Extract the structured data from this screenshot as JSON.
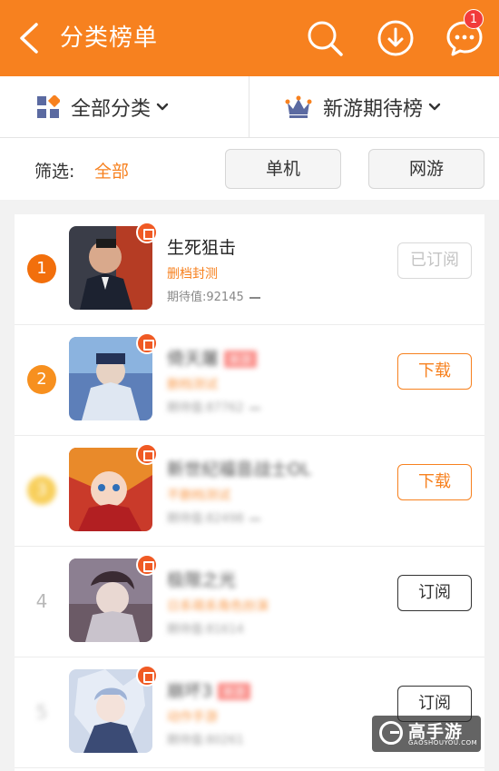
{
  "header": {
    "title": "分类榜单",
    "message_badge": "1",
    "icons": [
      "back-icon",
      "search-icon",
      "download-icon",
      "message-icon"
    ],
    "accent_color": "#f7811f"
  },
  "category_bar": {
    "left_label": "全部分类",
    "right_label": "新游期待榜"
  },
  "filter": {
    "label": "筛选:",
    "value": "全部",
    "buttons": [
      "单机",
      "网游"
    ]
  },
  "list": [
    {
      "rank": "1",
      "name": "生死狙击",
      "tag": "删档封测",
      "expect": "期待值:92145",
      "action": "已订阅"
    },
    {
      "rank": "2",
      "name": "倚天屠",
      "badge": "新游",
      "tag": "删档测试",
      "expect": "期待值:87762",
      "action": "下载"
    },
    {
      "rank": "3",
      "name": "新世纪福音战士OL",
      "tag": "不删档测试",
      "expect": "期待值:82498",
      "action": "下载"
    },
    {
      "rank": "4",
      "name": "极限之光",
      "tag": "日系萌系角色扮演",
      "expect": "期待值:81614",
      "action": "订阅"
    },
    {
      "rank": "5",
      "name": "崩坏3",
      "badge": "新游",
      "tag": "动作手游",
      "expect": "期待值:80261",
      "action": "订阅"
    }
  ],
  "watermark": {
    "name": "高手游",
    "domain": "GAOSHOUYOU.COM"
  }
}
